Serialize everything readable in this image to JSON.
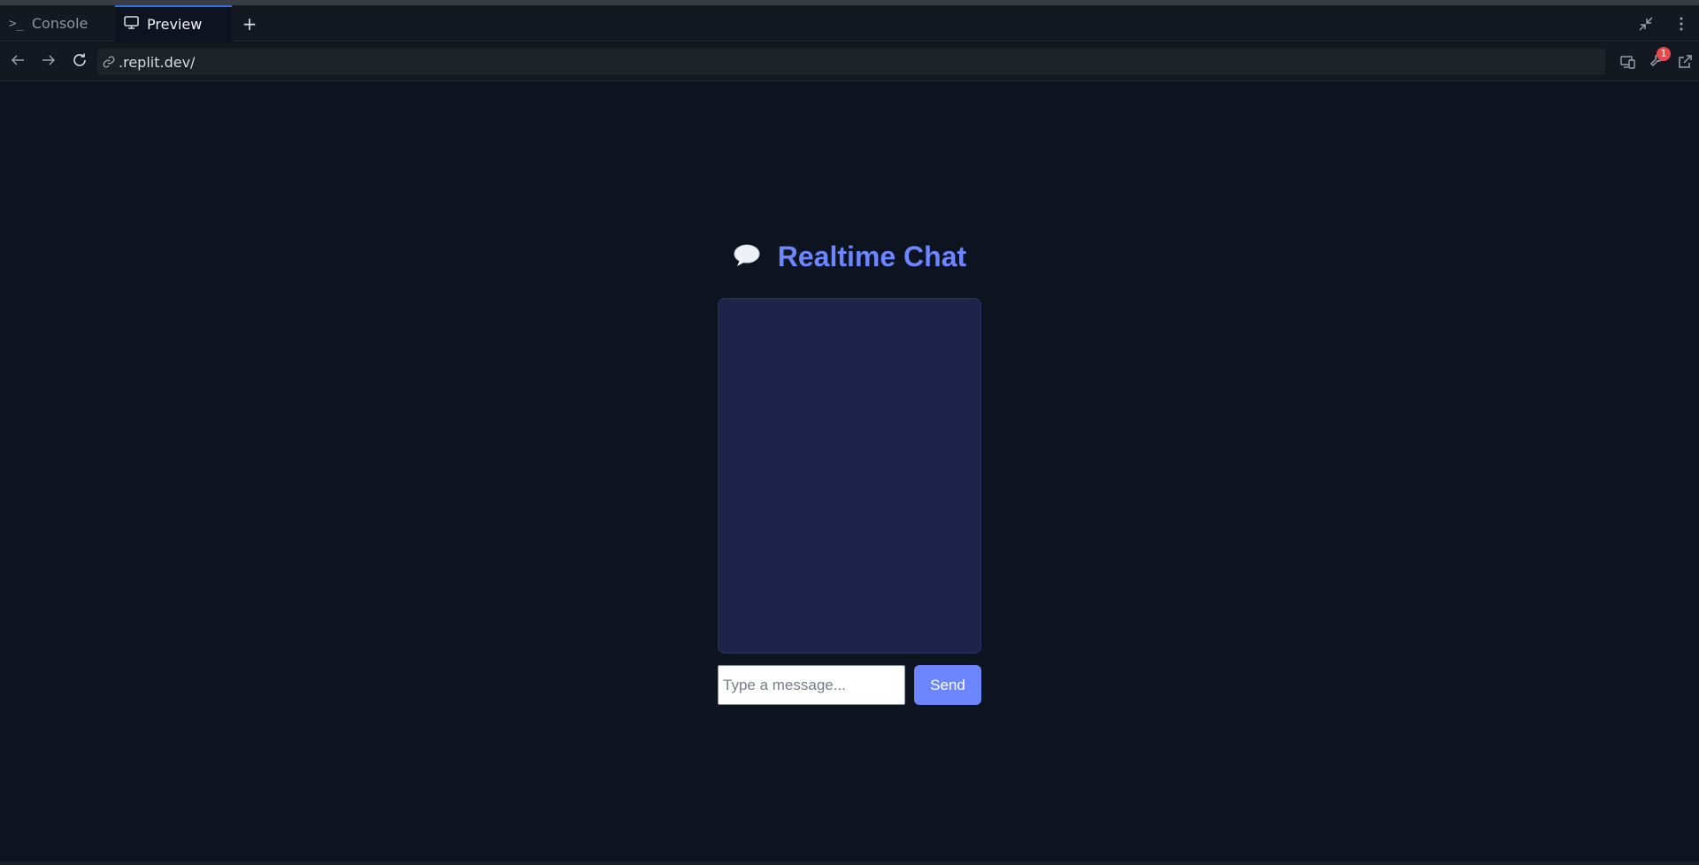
{
  "tabs": [
    {
      "label": "Console",
      "icon": "terminal-icon"
    },
    {
      "label": "Preview",
      "icon": "monitor-icon",
      "active": true
    }
  ],
  "tab_add_label": "+",
  "url": {
    "text": ".replit.dev/"
  },
  "toolbar": {
    "devtools_badge": "1"
  },
  "app": {
    "title_emoji": "💬",
    "title": "Realtime Chat",
    "input_placeholder": "Type a message...",
    "send_label": "Send"
  },
  "colors": {
    "accent": "#6b86ff",
    "page_background": "#0e1320",
    "chat_background": "#1e2449",
    "active_tab_indicator": "#2f6fe4",
    "badge": "#e5484d"
  }
}
